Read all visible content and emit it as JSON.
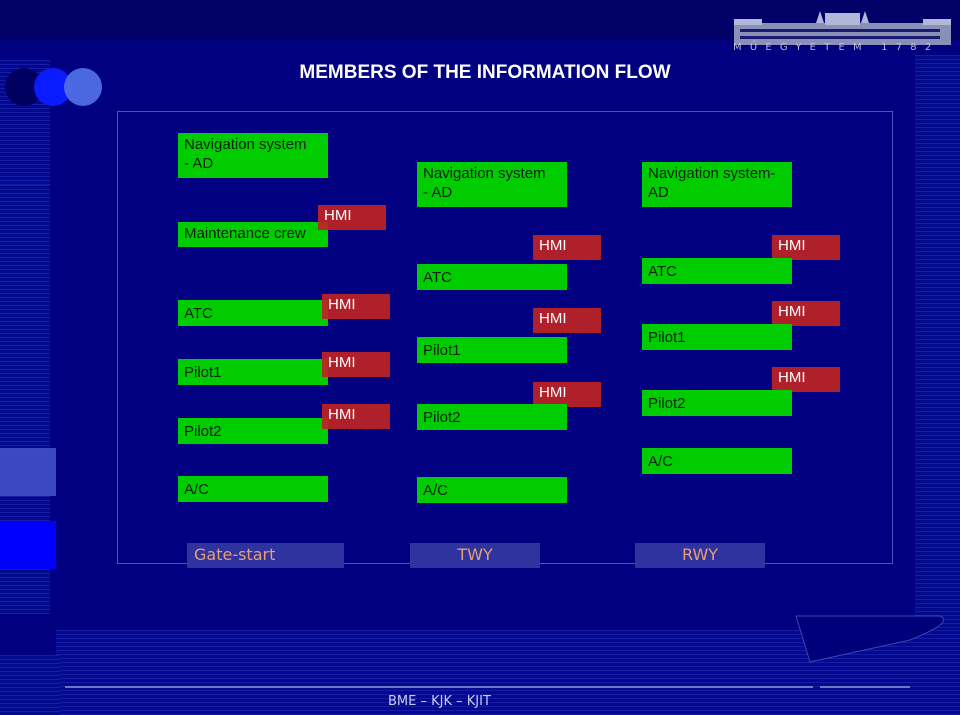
{
  "slide": {
    "title": "MEMBERS OF THE INFORMATION FLOW",
    "footer": "BME – KJK – KJIT",
    "logo_caption": "MŰEGYETEM 1782"
  },
  "colors": {
    "background": "#000080",
    "member_box": "#00cc00",
    "hmi_box": "#be2323",
    "phase_label_bg": "#2f33a0",
    "phase_label_text": "#e6a070"
  },
  "phases": [
    {
      "label": "Gate-start",
      "members": [
        {
          "name": "Navigation system\n- AD",
          "hmi": false
        },
        {
          "name": "Maintenance crew",
          "hmi": true
        },
        {
          "name": "ATC",
          "hmi": true
        },
        {
          "name": "Pilot1",
          "hmi": true
        },
        {
          "name": "Pilot2",
          "hmi": true
        },
        {
          "name": "A/C",
          "hmi": false
        }
      ]
    },
    {
      "label": "TWY",
      "members": [
        {
          "name": "Navigation system\n- AD",
          "hmi": false
        },
        {
          "name": "ATC",
          "hmi": true
        },
        {
          "name": "Pilot1",
          "hmi": true
        },
        {
          "name": "Pilot2",
          "hmi": true
        },
        {
          "name": "A/C",
          "hmi": false
        }
      ]
    },
    {
      "label": "RWY",
      "members": [
        {
          "name": "Navigation system-\nAD",
          "hmi": false
        },
        {
          "name": "ATC",
          "hmi": true
        },
        {
          "name": "Pilot1",
          "hmi": true
        },
        {
          "name": "Pilot2",
          "hmi": true
        },
        {
          "name": "A/C",
          "hmi": false
        }
      ]
    }
  ],
  "hmi_label": "HMI"
}
